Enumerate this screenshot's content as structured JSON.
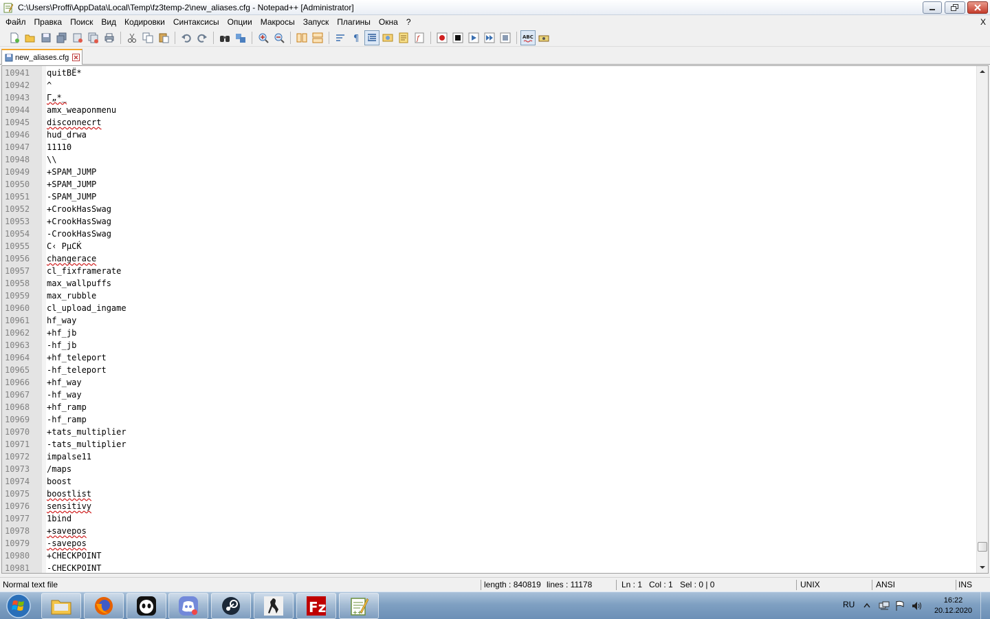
{
  "window": {
    "title": "C:\\Users\\Proffi\\AppData\\Local\\Temp\\fz3temp-2\\new_aliases.cfg - Notepad++ [Administrator]"
  },
  "menu": {
    "items": [
      "Файл",
      "Правка",
      "Поиск",
      "Вид",
      "Кодировки",
      "Синтаксисы",
      "Опции",
      "Макросы",
      "Запуск",
      "Плагины",
      "Окна",
      "?"
    ],
    "close_label": "X"
  },
  "toolbar": {
    "buttons": [
      "new-file",
      "open-file",
      "save",
      "save-all",
      "close",
      "close-all",
      "print",
      "cut",
      "copy",
      "paste",
      "undo",
      "redo",
      "find",
      "replace",
      "zoom-in",
      "zoom-out",
      "sync-vertical",
      "sync-horizontal",
      "word-wrap",
      "show-all-characters",
      "indent-guide",
      "user-defined-language",
      "document-map",
      "function-list",
      "folder-as-workspace",
      "record-macro",
      "stop-recording",
      "play-macro",
      "run-macro-multiple",
      "save-macro",
      "spell-check",
      "spell-check-options"
    ]
  },
  "tab": {
    "label": "new_aliases.cfg"
  },
  "editor": {
    "lines": [
      {
        "n": "10941",
        "text": "quitBЁ*",
        "spell": false
      },
      {
        "n": "10942",
        "text": "^",
        "spell": false
      },
      {
        "n": "10943",
        "text": "Г„*_",
        "spell": true
      },
      {
        "n": "10944",
        "text": "amx_weaponmenu",
        "spell": false
      },
      {
        "n": "10945",
        "text": "disconnecrt",
        "spell": true
      },
      {
        "n": "10946",
        "text": "hud_drwa",
        "spell": false
      },
      {
        "n": "10947",
        "text": "11110",
        "spell": false
      },
      {
        "n": "10948",
        "text": "\\\\",
        "spell": false
      },
      {
        "n": "10949",
        "text": "+SPAM_JUMP",
        "spell": false
      },
      {
        "n": "10950",
        "text": "+SPAM_JUMP",
        "spell": false
      },
      {
        "n": "10951",
        "text": "-SPAM_JUMP",
        "spell": false
      },
      {
        "n": "10952",
        "text": "+CrookHasSwag",
        "spell": false
      },
      {
        "n": "10953",
        "text": "+CrookHasSwag",
        "spell": false
      },
      {
        "n": "10954",
        "text": "-CrookHasSwag",
        "spell": false
      },
      {
        "n": "10955",
        "text": "С‹ РµСЌ",
        "spell": false
      },
      {
        "n": "10956",
        "text": "changerace",
        "spell": true
      },
      {
        "n": "10957",
        "text": "cl_fixframerate",
        "spell": false
      },
      {
        "n": "10958",
        "text": "max_wallpuffs",
        "spell": false
      },
      {
        "n": "10959",
        "text": "max_rubble",
        "spell": false
      },
      {
        "n": "10960",
        "text": "cl_upload_ingame",
        "spell": false
      },
      {
        "n": "10961",
        "text": "hf_way",
        "spell": false
      },
      {
        "n": "10962",
        "text": "+hf_jb",
        "spell": false
      },
      {
        "n": "10963",
        "text": "-hf_jb",
        "spell": false
      },
      {
        "n": "10964",
        "text": "+hf_teleport",
        "spell": false
      },
      {
        "n": "10965",
        "text": "-hf_teleport",
        "spell": false
      },
      {
        "n": "10966",
        "text": "+hf_way",
        "spell": false
      },
      {
        "n": "10967",
        "text": "-hf_way",
        "spell": false
      },
      {
        "n": "10968",
        "text": "+hf_ramp",
        "spell": false
      },
      {
        "n": "10969",
        "text": "-hf_ramp",
        "spell": false
      },
      {
        "n": "10970",
        "text": "+tats_multiplier",
        "spell": false
      },
      {
        "n": "10971",
        "text": "-tats_multiplier",
        "spell": false
      },
      {
        "n": "10972",
        "text": "impalse11",
        "spell": false
      },
      {
        "n": "10973",
        "text": "/maps",
        "spell": false
      },
      {
        "n": "10974",
        "text": "boost",
        "spell": false
      },
      {
        "n": "10975",
        "text": "boostlist",
        "spell": true
      },
      {
        "n": "10976",
        "text": "sensitivy",
        "spell": true
      },
      {
        "n": "10977",
        "text": "1bind",
        "spell": false
      },
      {
        "n": "10978",
        "text": "+savepos",
        "spell": true
      },
      {
        "n": "10979",
        "text": "-savepos",
        "spell": true
      },
      {
        "n": "10980",
        "text": "+CHECKPOINT",
        "spell": false
      },
      {
        "n": "10981",
        "text": "-CHECKPOINT",
        "spell": false
      }
    ]
  },
  "status": {
    "file_type": "Normal text file",
    "length": "length : 840819",
    "lines": "lines : 11178",
    "ln": "Ln : 1",
    "col": "Col : 1",
    "sel": "Sel : 0 | 0",
    "eol": "UNIX",
    "encoding": "ANSI",
    "mode": "INS"
  },
  "taskbar": {
    "apps": [
      "explorer",
      "firefox",
      "panda-vpn",
      "discord",
      "steam",
      "counter-strike",
      "filezilla",
      "notepad-plus-plus"
    ],
    "language": "RU",
    "time": "16:22",
    "date": "20.12.2020"
  },
  "colors": {
    "tab_accent": "#f4a62a",
    "spell_underline": "#d02020",
    "gutter": "#e4e4e4",
    "line_number": "#808080"
  }
}
